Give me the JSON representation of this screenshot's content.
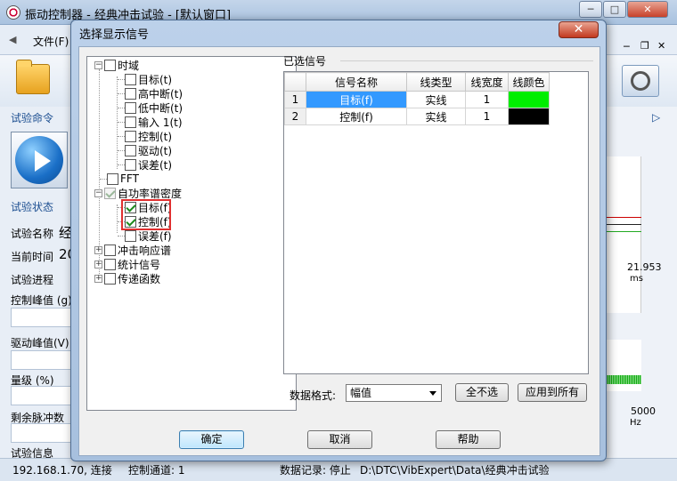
{
  "app": {
    "title": "振动控制器 - 经典冲击试验 - [默认窗口]",
    "window_buttons": {
      "minimize": "─",
      "maximize": "□",
      "close": "✕"
    },
    "menu": {
      "file": "文件(F)"
    },
    "mdi_buttons": {
      "minimize": "─",
      "restore": "❐",
      "close": "✕"
    },
    "left": {
      "commands_head": "试验命令",
      "status_head": "试验状态",
      "test_name_label": "试验名称",
      "test_name_value": "经",
      "current_time_label": "当前时间",
      "current_time_value": "20",
      "progress_label": "试验进程",
      "ctrl_peak_label": "控制峰值 (g)",
      "drive_peak_label": "驱动峰值(V)",
      "level_label": "量级 (%)",
      "remaining_label": "剩余脉冲数",
      "info_label": "试验信息"
    },
    "right": {
      "time_value": "21.953",
      "time_unit": "ms",
      "freq_value": "5000",
      "freq_unit": "Hz",
      "arrow": "▷"
    },
    "status": {
      "connection": "192.168.1.70, 连接",
      "channel": "控制通道: 1",
      "record": "数据记录: 停止",
      "path": "D:\\DTC\\VibExpert\\Data\\经典冲击试验"
    }
  },
  "dialog": {
    "title": "选择显示信号",
    "close": "✕",
    "tree": {
      "time_domain": "时域",
      "td_target": "目标(t)",
      "td_highcut": "高中断(t)",
      "td_lowcut": "低中断(t)",
      "td_input": "输入 1(t)",
      "td_control": "控制(t)",
      "td_drive": "驱动(t)",
      "td_error": "误差(t)",
      "fft": "FFT",
      "psd": "自功率谱密度",
      "psd_target": "目标(f)",
      "psd_control": "控制(f)",
      "psd_error": "误差(f)",
      "srs": "冲击响应谱",
      "stats": "统计信号",
      "transfer": "传递函数"
    },
    "selected_group": "已选信号",
    "table": {
      "headers": [
        "信号名称",
        "线类型",
        "线宽度",
        "线颜色"
      ],
      "rows": [
        {
          "num": "1",
          "name": "目标(f)",
          "type": "实线",
          "width": "1",
          "color": "#00ee00"
        },
        {
          "num": "2",
          "name": "控制(f)",
          "type": "实线",
          "width": "1",
          "color": "#000000"
        }
      ]
    },
    "format_label": "数据格式:",
    "format_value": "幅值",
    "btn_none": "全不选",
    "btn_apply_all": "应用到所有",
    "btn_ok": "确定",
    "btn_cancel": "取消",
    "btn_help": "帮助"
  }
}
